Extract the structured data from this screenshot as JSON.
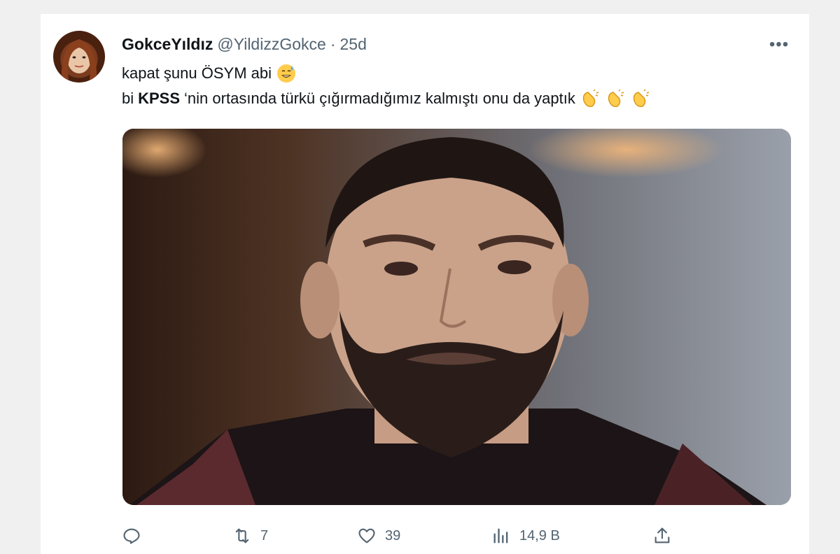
{
  "tweet": {
    "display_name": "GokceYıldız",
    "handle": "@YildizzGokce",
    "separator": "·",
    "time": "25d",
    "more_label": "•••",
    "line1_text": "kapat şunu ÖSYM abi",
    "line2_prefix": "bi",
    "line2_bold": "KPSS",
    "line2_rest": "‘nin ortasında türkü çığırmadığımız kalmıştı onu da yaptık",
    "line1_emoji_icon": "grinning-sweat-emoji-icon",
    "line2_emoji_icons": [
      "clapping-hands-icon",
      "clapping-hands-icon",
      "clapping-hands-icon"
    ]
  },
  "actions": {
    "reply_icon": "reply-icon",
    "retweet_icon": "retweet-icon",
    "retweets": "7",
    "like_icon": "heart-icon",
    "likes": "39",
    "views_icon": "views-chart-icon",
    "views": "14,9 B",
    "share_icon": "share-icon"
  },
  "colors": {
    "text_primary": "#0f1419",
    "text_secondary": "#536471",
    "background": "#ffffff"
  }
}
